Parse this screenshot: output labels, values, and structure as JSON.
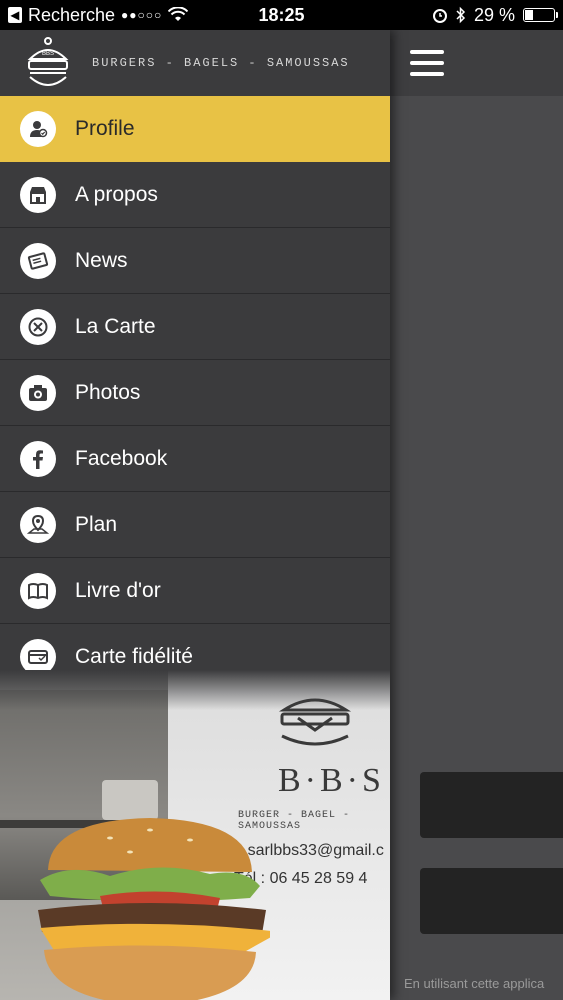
{
  "status_bar": {
    "back_app": "Recherche",
    "signal": "●●○○○",
    "time": "18:25",
    "battery": "29 %",
    "battery_level": 0.29
  },
  "brand": {
    "logo_text": "BBS",
    "tagline": "BURGERS - BAGELS - SAMOUSSAS"
  },
  "menu": {
    "items": [
      {
        "label": "Profile",
        "icon": "profile-icon",
        "active": true
      },
      {
        "label": "A propos",
        "icon": "shop-icon"
      },
      {
        "label": "News",
        "icon": "newspaper-icon"
      },
      {
        "label": "La Carte",
        "icon": "cutlery-icon"
      },
      {
        "label": "Photos",
        "icon": "camera-icon"
      },
      {
        "label": "Facebook",
        "icon": "facebook-icon"
      },
      {
        "label": "Plan",
        "icon": "map-pin-icon"
      },
      {
        "label": "Livre d'or",
        "icon": "book-icon"
      },
      {
        "label": "Carte fidélité",
        "icon": "card-icon"
      }
    ]
  },
  "photo": {
    "brand_title": "B·B·S",
    "brand_sub": "BURGER - BAGEL - SAMOUSSAS",
    "email": "@ : sarlbbs33@gmail.c",
    "tel": "Tél : 06 45 28 59 4"
  },
  "content": {
    "footer_text": "En utilisant cette applica"
  },
  "colors": {
    "accent": "#e8c245",
    "drawer_bg": "#3b3b3d",
    "content_bg": "#4a4a4c"
  }
}
